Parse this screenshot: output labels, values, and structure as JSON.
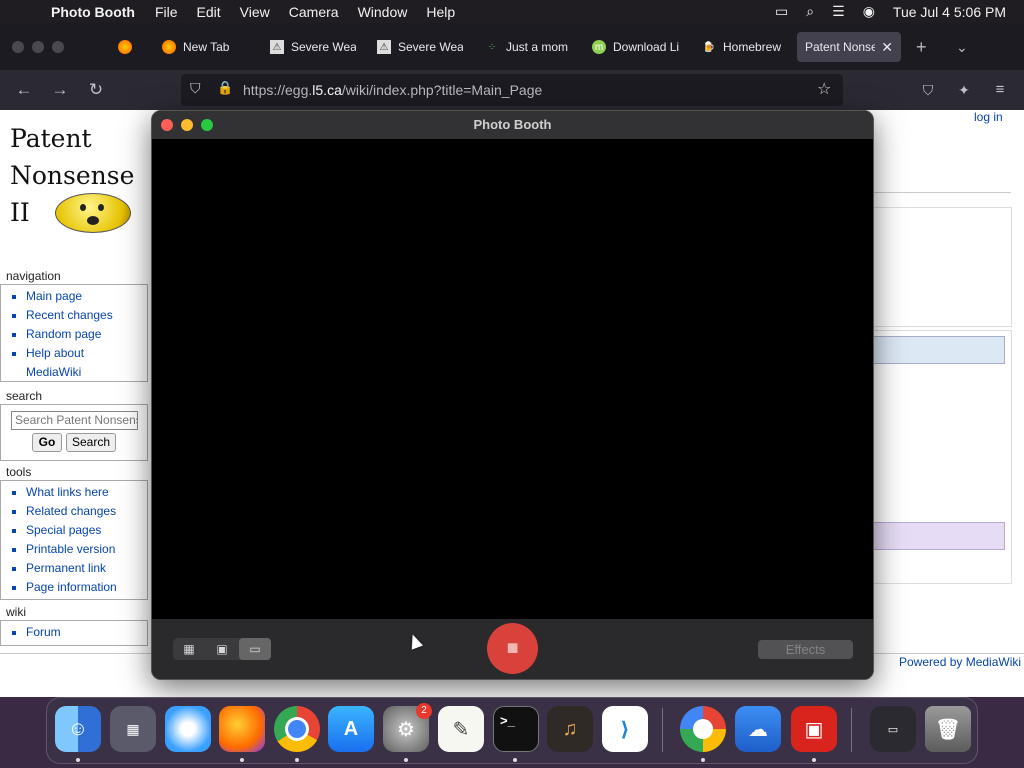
{
  "menubar": {
    "app_name": "Photo Booth",
    "items": [
      "File",
      "Edit",
      "View",
      "Camera",
      "Window",
      "Help"
    ],
    "datetime": "Tue Jul 4  5:06 PM"
  },
  "browser": {
    "tabs": [
      {
        "label": "New Tab",
        "icon": "firefox-icon"
      },
      {
        "label": "Severe Wea",
        "icon": "warning-icon"
      },
      {
        "label": "Severe Wea",
        "icon": "warning-icon"
      },
      {
        "label": "Just a mom",
        "icon": "loading-icon"
      },
      {
        "label": "Download Li",
        "icon": "mint-icon"
      },
      {
        "label": "Homebrew",
        "icon": "beer-icon"
      },
      {
        "label": "Patent Nonse",
        "icon": "",
        "active": true
      }
    ],
    "url_prefix": "https://egg.",
    "url_domain": "l5.ca",
    "url_suffix": "/wiki/index.php?title=Main_Page"
  },
  "wiki": {
    "logo_lines": [
      "Patent",
      "Nonsense",
      "II"
    ],
    "login": "log in",
    "powered": "Powered by MediaWiki",
    "navigation": {
      "heading": "navigation",
      "items": [
        "Main page",
        "Recent changes",
        "Random page",
        "Help about",
        "MediaWiki"
      ]
    },
    "search": {
      "heading": "search",
      "placeholder": "Search Patent Nonsense",
      "go": "Go",
      "search": "Search"
    },
    "tools": {
      "heading": "tools",
      "items": [
        "What links here",
        "Related changes",
        "Special pages",
        "Printable version",
        "Permanent link",
        "Page information"
      ]
    },
    "wiki": {
      "heading": "wiki",
      "items": [
        "Forum"
      ]
    }
  },
  "photobooth": {
    "title": "Photo Booth",
    "effects": "Effects",
    "record_icon": "video-camera-icon"
  },
  "dock": {
    "badge": "2"
  }
}
